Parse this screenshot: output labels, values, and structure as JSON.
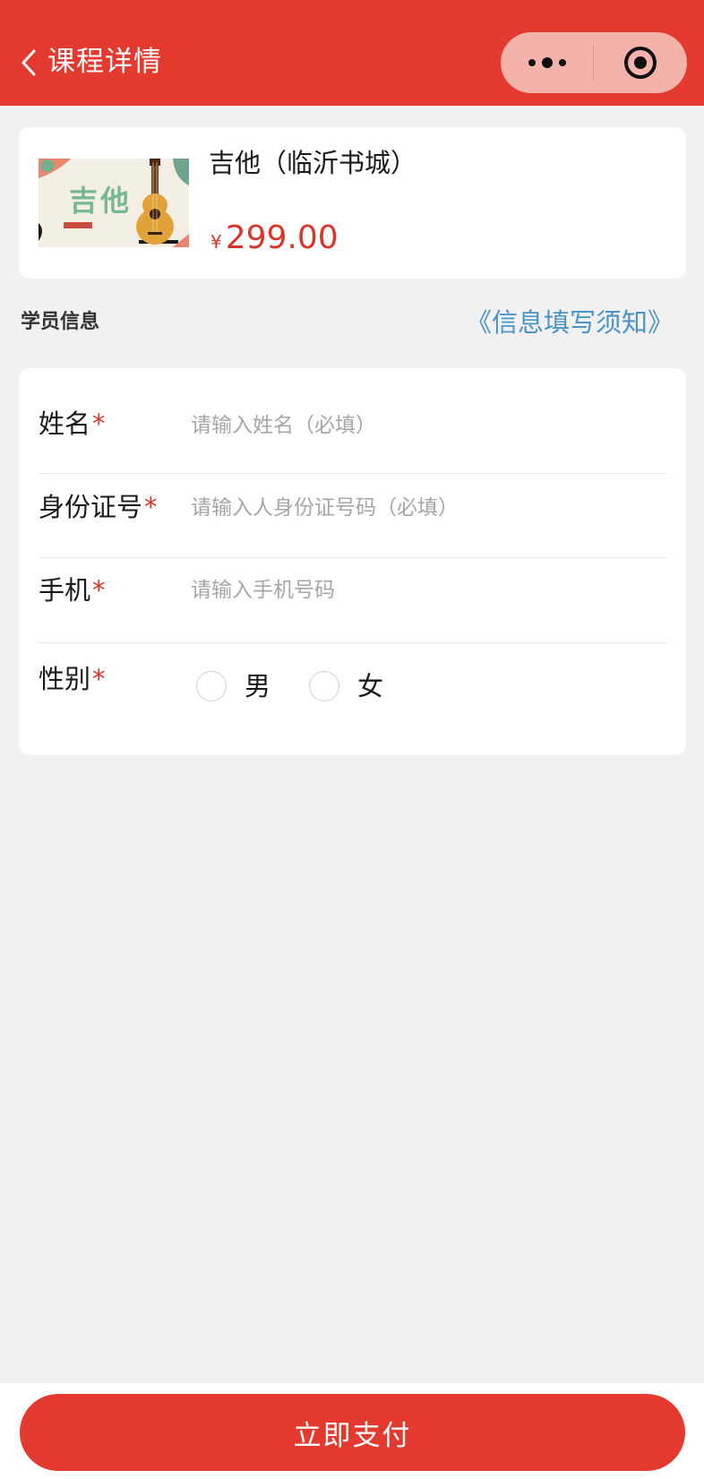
{
  "nav": {
    "title": "课程详情",
    "back_icon": "chevron-left-icon",
    "more_icon": "more-dots-icon",
    "close_icon": "target-circle-icon",
    "bg_color": "#e4392f"
  },
  "product": {
    "image_text": "吉他",
    "title": "吉他（临沂书城）",
    "price_symbol": "¥",
    "price": "299.00",
    "price_color": "#d6372d"
  },
  "section": {
    "label": "学员信息",
    "notice_link": "《信息填写须知》"
  },
  "form": {
    "required_mark": "*",
    "fields": [
      {
        "label": "姓名",
        "placeholder": "请输入姓名（必填）",
        "value": ""
      },
      {
        "label": "身份证号",
        "placeholder": "请输入人身份证号码（必填）",
        "value": ""
      },
      {
        "label": "手机",
        "placeholder": "请输入手机号码",
        "value": ""
      }
    ],
    "gender": {
      "label": "性别",
      "options": [
        "男",
        "女"
      ],
      "selected": null
    }
  },
  "footer": {
    "pay_label": "立即支付"
  },
  "colors": {
    "accent": "#e4392f",
    "link": "#4a94c6",
    "background": "#f1f1f1"
  }
}
